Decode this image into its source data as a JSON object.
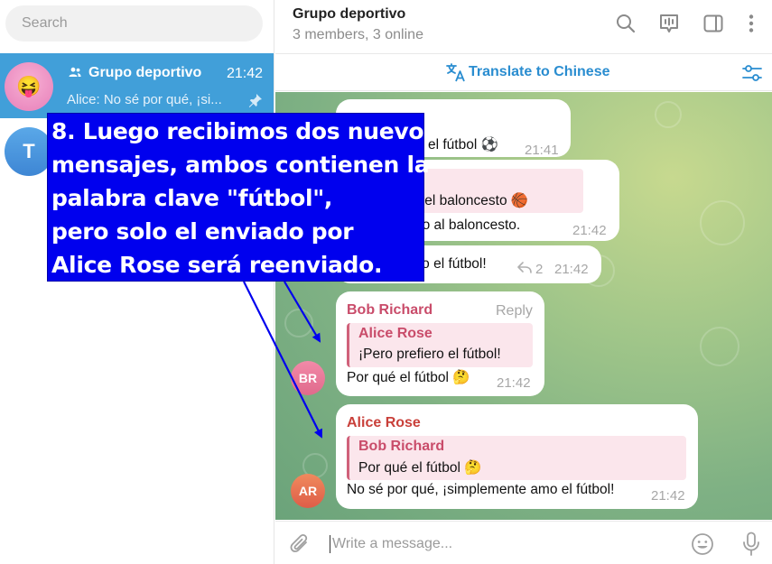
{
  "search": {
    "placeholder": "Search"
  },
  "chat_list": {
    "active": {
      "avatar": "😝",
      "title": "Grupo deportivo",
      "time": "21:42",
      "preview": "Alice: No sé por qué, ¡si..."
    },
    "second": {
      "avatar": "T"
    }
  },
  "header": {
    "title": "Grupo deportivo",
    "subtitle": "3 members, 3 online",
    "icons": [
      "search-icon",
      "live-stream-icon",
      "sidebar-toggle-icon",
      "more-vertical-icon"
    ]
  },
  "translate_bar": {
    "label": "Translate to Chinese"
  },
  "messages": [
    {
      "text": "el fútbol ⚽",
      "time": "21:41"
    },
    {
      "quote_name": "rd",
      "quote_text": "ta el baloncesto 🏀",
      "text": "go al baloncesto.",
      "time": "21:42"
    },
    {
      "text": "ro el fútbol!",
      "replies": "2",
      "time": "21:42"
    },
    {
      "sender": "Bob Richard",
      "reply_label": "Reply",
      "quote_name": "Alice Rose",
      "quote_text": "¡Pero prefiero el fútbol!",
      "text": "Por qué el fútbol 🤔",
      "time": "21:42",
      "avatar": "BR"
    },
    {
      "sender": "Alice Rose",
      "quote_name": "Bob Richard",
      "quote_text": "Por qué el fútbol 🤔",
      "text": "No sé por qué, ¡simplemente amo el fútbol!",
      "time": "21:42",
      "avatar": "AR"
    }
  ],
  "composer": {
    "placeholder": "Write a message..."
  },
  "annotation": {
    "lines": [
      "8. Luego recibimos dos nuevos",
      "mensajes, ambos contienen la",
      "palabra clave \"fútbol\",",
      "pero solo el enviado por",
      "Alice Rose será reenviado."
    ]
  },
  "colors": {
    "accent": "#419fd9",
    "translate": "#2a8dd0",
    "bob_name": "#c94c6a",
    "alice_name": "#c9403a",
    "callout_bg": "#0000ee",
    "arrow": "#0000ee"
  }
}
